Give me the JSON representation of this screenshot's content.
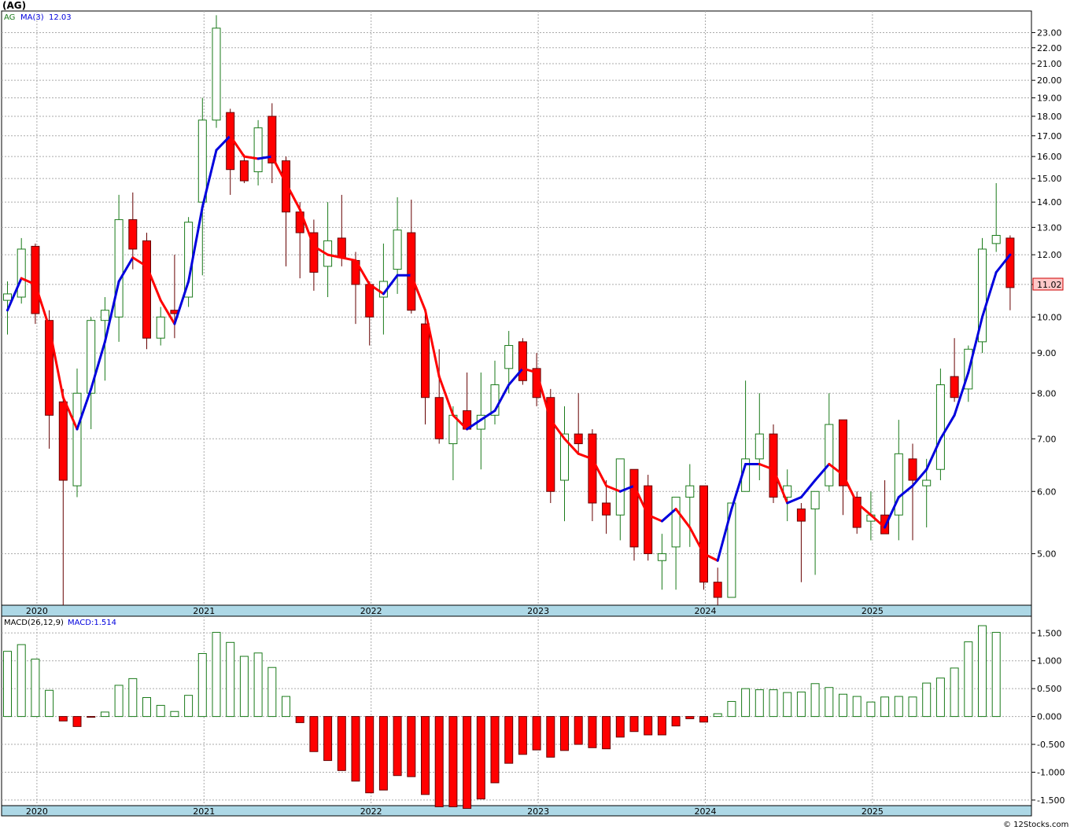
{
  "header": {
    "title": "(AG)"
  },
  "legend": {
    "symbol": "AG",
    "ma_label": "MA(3)",
    "ma_value": "12.03",
    "macd_label": "MACD(26,12,9)",
    "macd_value": "MACD:1.514"
  },
  "last_price_tag": "11.02",
  "watermark": "© 12Stocks.com",
  "colors": {
    "up": "#1a7a1a",
    "down": "#ff0000",
    "ma_up": "#0000dd",
    "ma_down": "#ff0000",
    "axis_band": "#add8e6"
  },
  "chart_data": [
    {
      "type": "candlestick",
      "scale": "log",
      "ylim": [
        4.3,
        24.5
      ],
      "y_ticks": [
        "5.00",
        "6.00",
        "7.00",
        "8.00",
        "9.00",
        "10.00",
        "11.00",
        "12.00",
        "13.00",
        "14.00",
        "15.00",
        "16.00",
        "17.00",
        "18.00",
        "19.00",
        "20.00",
        "21.00",
        "22.00",
        "23.00"
      ],
      "x_labels": [
        "2020",
        "2021",
        "2022",
        "2023",
        "2024",
        "2025"
      ],
      "x_label_index": [
        2,
        14,
        26,
        38,
        50,
        62
      ],
      "ma_period": 3,
      "ohlc": [
        [
          10.5,
          11.1,
          9.5,
          10.7
        ],
        [
          10.6,
          12.6,
          10.4,
          12.2
        ],
        [
          12.3,
          12.4,
          9.8,
          10.1
        ],
        [
          9.9,
          10.2,
          6.8,
          7.5
        ],
        [
          7.8,
          8.1,
          4.3,
          6.2
        ],
        [
          6.1,
          8.6,
          5.9,
          8.0
        ],
        [
          8.0,
          10.0,
          7.2,
          9.9
        ],
        [
          9.9,
          10.6,
          8.3,
          10.2
        ],
        [
          10.0,
          14.3,
          9.3,
          13.3
        ],
        [
          13.3,
          14.4,
          11.5,
          12.2
        ],
        [
          12.5,
          12.8,
          9.1,
          9.4
        ],
        [
          9.4,
          10.3,
          9.2,
          10.0
        ],
        [
          10.2,
          12.0,
          9.4,
          10.1
        ],
        [
          10.6,
          13.4,
          10.3,
          13.2
        ],
        [
          14.0,
          19.0,
          11.3,
          17.8
        ],
        [
          17.8,
          24.2,
          17.4,
          23.3
        ],
        [
          18.2,
          18.4,
          14.3,
          15.4
        ],
        [
          15.8,
          16.1,
          14.8,
          14.9
        ],
        [
          15.3,
          17.8,
          14.7,
          17.4
        ],
        [
          18.0,
          18.7,
          14.8,
          15.7
        ],
        [
          15.8,
          16.0,
          11.6,
          13.6
        ],
        [
          13.6,
          14.0,
          11.2,
          12.8
        ],
        [
          12.8,
          13.3,
          10.8,
          11.4
        ],
        [
          11.6,
          14.0,
          10.6,
          12.5
        ],
        [
          12.6,
          14.3,
          11.6,
          11.9
        ],
        [
          11.8,
          12.1,
          9.8,
          11.0
        ],
        [
          11.0,
          11.1,
          9.2,
          10.0
        ],
        [
          10.6,
          12.4,
          9.5,
          11.1
        ],
        [
          11.5,
          14.2,
          10.7,
          12.9
        ],
        [
          12.8,
          14.1,
          10.1,
          10.2
        ],
        [
          9.8,
          10.2,
          7.3,
          7.9
        ],
        [
          7.9,
          9.1,
          6.9,
          7.0
        ],
        [
          6.9,
          7.7,
          6.2,
          7.5
        ],
        [
          7.6,
          8.5,
          7.2,
          7.2
        ],
        [
          7.2,
          8.5,
          6.4,
          7.5
        ],
        [
          7.5,
          8.8,
          7.3,
          8.2
        ],
        [
          8.6,
          9.6,
          8.0,
          9.2
        ],
        [
          9.3,
          9.4,
          8.2,
          8.3
        ],
        [
          8.6,
          9.0,
          7.7,
          7.9
        ],
        [
          7.9,
          8.1,
          5.8,
          6.0
        ],
        [
          6.2,
          7.7,
          5.5,
          7.1
        ],
        [
          7.1,
          8.0,
          6.7,
          6.9
        ],
        [
          7.1,
          7.2,
          5.5,
          5.8
        ],
        [
          5.8,
          6.2,
          5.3,
          5.6
        ],
        [
          5.6,
          6.6,
          5.2,
          6.6
        ],
        [
          6.4,
          6.4,
          4.9,
          5.1
        ],
        [
          6.1,
          6.3,
          4.9,
          5.0
        ],
        [
          4.9,
          5.3,
          4.5,
          5.0
        ],
        [
          5.1,
          5.5,
          4.5,
          5.9
        ],
        [
          5.9,
          6.5,
          5.1,
          6.1
        ],
        [
          6.1,
          6.1,
          4.5,
          4.6
        ],
        [
          4.6,
          4.8,
          4.3,
          4.4
        ],
        [
          4.4,
          5.8,
          4.4,
          5.8
        ],
        [
          6.0,
          8.3,
          6.0,
          6.6
        ],
        [
          6.6,
          8.0,
          6.2,
          7.1
        ],
        [
          7.1,
          7.3,
          5.8,
          5.9
        ],
        [
          5.9,
          6.4,
          5.5,
          6.1
        ],
        [
          5.7,
          5.8,
          4.6,
          5.5
        ],
        [
          5.7,
          6.0,
          4.7,
          6.0
        ],
        [
          6.1,
          8.0,
          6.0,
          7.3
        ],
        [
          7.4,
          7.4,
          5.6,
          6.1
        ],
        [
          5.9,
          6.0,
          5.3,
          5.4
        ],
        [
          5.5,
          6.0,
          5.2,
          5.6
        ],
        [
          5.6,
          6.2,
          5.3,
          5.3
        ],
        [
          5.6,
          7.4,
          5.2,
          6.7
        ],
        [
          6.6,
          6.9,
          5.2,
          6.2
        ],
        [
          6.1,
          6.6,
          5.4,
          6.2
        ],
        [
          6.4,
          8.6,
          6.2,
          8.2
        ],
        [
          8.4,
          9.4,
          7.8,
          7.9
        ],
        [
          8.1,
          9.2,
          7.8,
          9.1
        ],
        [
          9.3,
          12.6,
          9.0,
          12.2
        ],
        [
          12.4,
          14.8,
          12.1,
          12.7
        ],
        [
          12.6,
          12.7,
          10.2,
          10.9
        ]
      ],
      "ma": [
        10.2,
        11.2,
        11.0,
        9.7,
        7.9,
        7.2,
        8.1,
        9.3,
        11.1,
        11.9,
        11.6,
        10.5,
        9.8,
        11.1,
        13.8,
        16.3,
        17.0,
        16.0,
        15.9,
        16.0,
        14.8,
        13.7,
        12.3,
        12.0,
        11.9,
        11.8,
        11.0,
        10.7,
        11.3,
        11.3,
        10.2,
        8.4,
        7.5,
        7.2,
        7.4,
        7.6,
        8.2,
        8.6,
        8.5,
        7.4,
        7.0,
        6.7,
        6.6,
        6.1,
        6.0,
        6.1,
        5.6,
        5.5,
        5.7,
        5.4,
        5.0,
        4.9,
        5.7,
        6.5,
        6.5,
        6.4,
        5.8,
        5.9,
        6.2,
        6.5,
        6.3,
        5.8,
        5.6,
        5.4,
        5.9,
        6.1,
        6.4,
        7.0,
        7.5,
        8.5,
        10.0,
        11.4,
        12.0
      ]
    },
    {
      "type": "bar",
      "name": "MACD(26,12,9)",
      "ylim": [
        -1.6,
        1.8
      ],
      "y_ticks": [
        "1.500",
        "1.000",
        "0.500",
        "0.000",
        "-0.500",
        "-1.000",
        "-1.500"
      ],
      "x_labels": [
        "2020",
        "2021",
        "2022",
        "2023",
        "2024",
        "2025"
      ],
      "values": [
        1.17,
        1.29,
        1.03,
        0.47,
        -0.08,
        -0.18,
        -0.01,
        0.08,
        0.56,
        0.68,
        0.34,
        0.2,
        0.09,
        0.38,
        1.13,
        1.51,
        1.33,
        1.08,
        1.14,
        0.88,
        0.36,
        -0.11,
        -0.63,
        -0.79,
        -0.97,
        -1.16,
        -1.37,
        -1.32,
        -1.06,
        -1.08,
        -1.4,
        -1.62,
        -1.62,
        -1.65,
        -1.48,
        -1.19,
        -0.84,
        -0.68,
        -0.6,
        -0.73,
        -0.61,
        -0.5,
        -0.56,
        -0.58,
        -0.37,
        -0.27,
        -0.33,
        -0.33,
        -0.17,
        -0.04,
        -0.1,
        0.05,
        0.27,
        0.5,
        0.48,
        0.48,
        0.43,
        0.44,
        0.59,
        0.52,
        0.4,
        0.36,
        0.26,
        0.35,
        0.36,
        0.35,
        0.6,
        0.69,
        0.87,
        1.34,
        1.63,
        1.51
      ]
    }
  ]
}
